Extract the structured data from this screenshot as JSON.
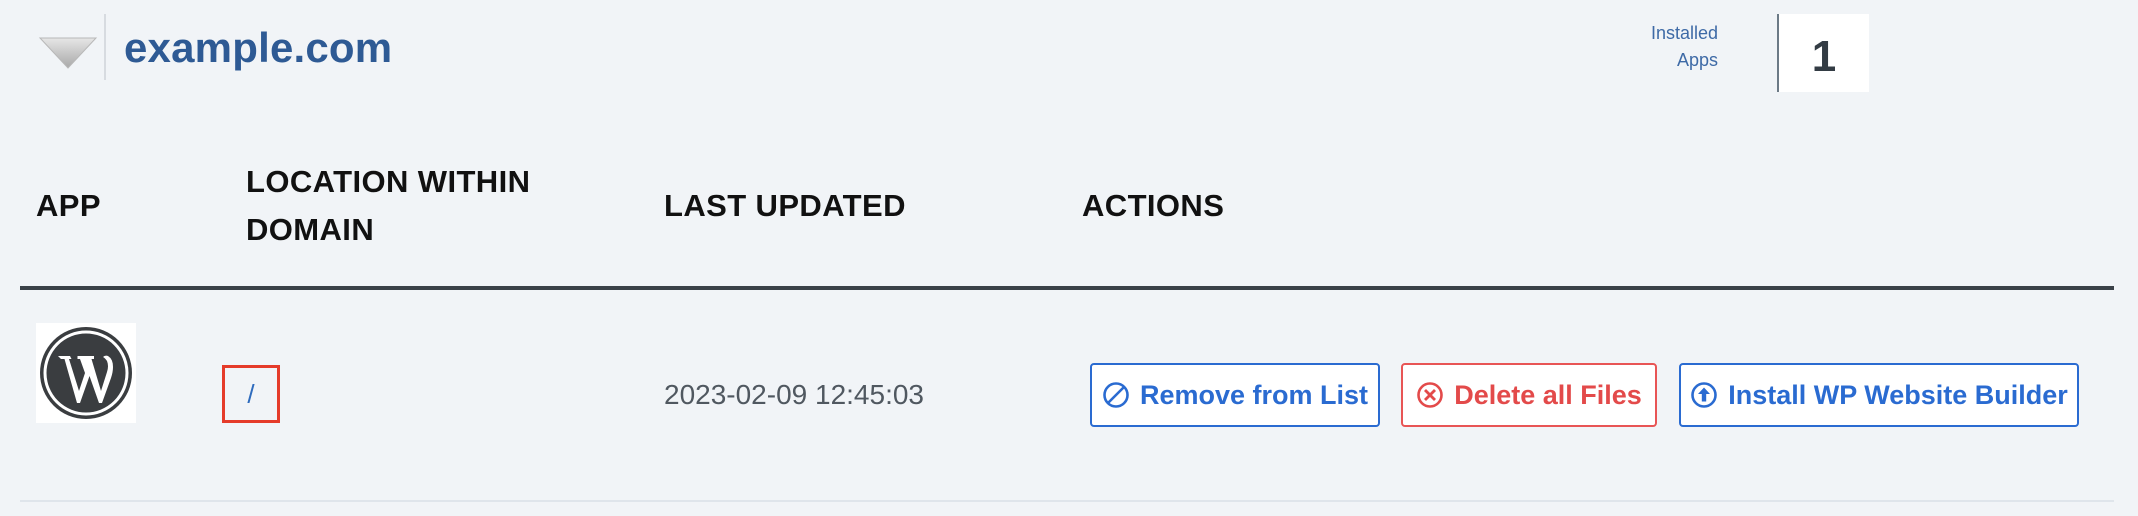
{
  "header": {
    "domain": "example.com",
    "installed_label_line1": "Installed",
    "installed_label_line2": "Apps",
    "installed_count": "1"
  },
  "table": {
    "columns": {
      "app": "APP",
      "location_line1": "LOCATION WITHIN",
      "location_line2": "DOMAIN",
      "last_updated": "LAST UPDATED",
      "actions": "ACTIONS"
    },
    "rows": [
      {
        "app_icon": "wordpress-logo",
        "location": "/",
        "last_updated": "2023-02-09 12:45:03",
        "actions": {
          "remove": "Remove from List",
          "delete": "Delete all Files",
          "install": "Install WP Website Builder"
        }
      }
    ]
  },
  "icons": {
    "toggle": "triangle-down-icon",
    "remove": "circle-slash-icon",
    "delete": "circle-x-icon",
    "install": "circle-arrow-up-icon"
  },
  "colors": {
    "domain": "#2e5a94",
    "link": "#2e6bbd",
    "action_blue": "#2a6bd1",
    "action_red": "#e34a4a",
    "highlight_border": "#e53b2a",
    "background": "#f1f4f7"
  }
}
